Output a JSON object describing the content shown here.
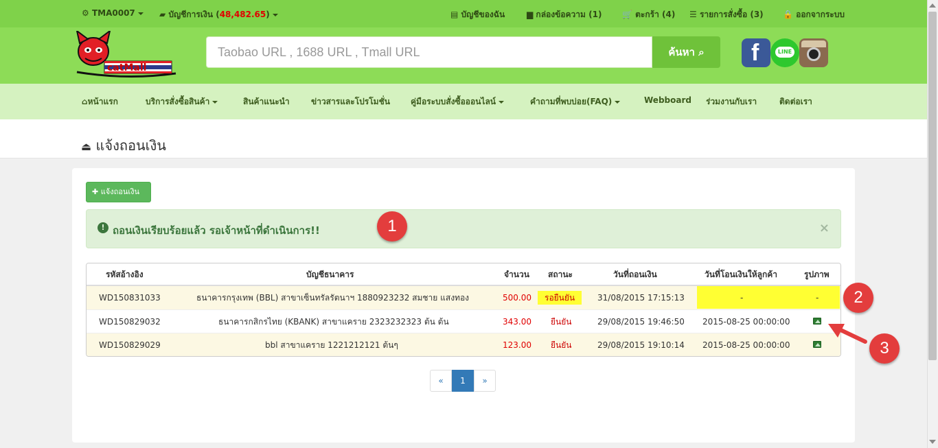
{
  "topbar": {
    "user": "TMA0007",
    "account_label": "บัญชีการเงิน (",
    "account_balance": "48,482.65",
    "account_close": ")",
    "my_account": "บัญชีของฉัน",
    "inbox": "กล่องข้อความ (1)",
    "cart": "ตะกร้า (4)",
    "orders": "รายการสั่งซื้อ (3)",
    "logout": "ออกจากระบบ"
  },
  "brand": {
    "logo_text": "catMall"
  },
  "search": {
    "placeholder": "Taobao URL , 1688 URL , Tmall URL",
    "button": "ค้นหา"
  },
  "social": {
    "line": "LINE"
  },
  "nav": {
    "items": [
      {
        "label": "หน้าแรก"
      },
      {
        "label": "บริการสั่งซื้อสินค้า"
      },
      {
        "label": "สินค้าแนะนำ"
      },
      {
        "label": "ข่าวสารและโปรโมชั่น"
      },
      {
        "label": "คู่มือระบบสั่งซื้อออนไลน์"
      },
      {
        "label": "คำถามที่พบบ่อย(FAQ)"
      },
      {
        "label": "Webboard"
      },
      {
        "label": "ร่วมงานกับเรา"
      },
      {
        "label": "ติดต่อเรา"
      }
    ]
  },
  "page": {
    "title": "แจ้งถอนเงิน"
  },
  "actions": {
    "add_button": "แจ้งถอนเงิน"
  },
  "alert": {
    "message": "ถอนเงินเรียบร้อยแล้ว รอเจ้าหน้าที่ดำเนินการ!!",
    "close": "×"
  },
  "badges": [
    "1",
    "2",
    "3"
  ],
  "table": {
    "headers": [
      "รหัสอ้างอิง",
      "บัญชีธนาคาร",
      "จำนวน",
      "สถานะ",
      "วันที่ถอนเงิน",
      "วันที่โอนเงินให้ลูกค้า",
      "รูปภาพ"
    ],
    "rows": [
      {
        "ref": "WD150831033",
        "bank": "ธนาคารกรุงเทพ (BBL)   สาขาเซ็นทรัลรัตนาฯ   1880923232   สมชาย แสงทอง",
        "amount": "500.00",
        "status": "รอยืนยัน",
        "withdraw_date": "31/08/2015 17:15:13",
        "transfer_date": "-",
        "image": "-"
      },
      {
        "ref": "WD150829032",
        "bank": "ธนาคารกสิกรไทย (KBANK)   สาขาแคราย   2323232323   ต้น ต้น",
        "amount": "343.00",
        "status": "ยืนยัน",
        "withdraw_date": "29/08/2015 19:46:50",
        "transfer_date": "2015-08-25 00:00:00",
        "image": ""
      },
      {
        "ref": "WD150829029",
        "bank": "bbl   สาขาแคราย   1221212121   ต้นๆ",
        "amount": "123.00",
        "status": "ยืนยัน",
        "withdraw_date": "29/08/2015 19:10:14",
        "transfer_date": "2015-08-25 00:00:00",
        "image": ""
      }
    ]
  },
  "pagination": {
    "prev": "«",
    "current": "1",
    "next": "»"
  }
}
